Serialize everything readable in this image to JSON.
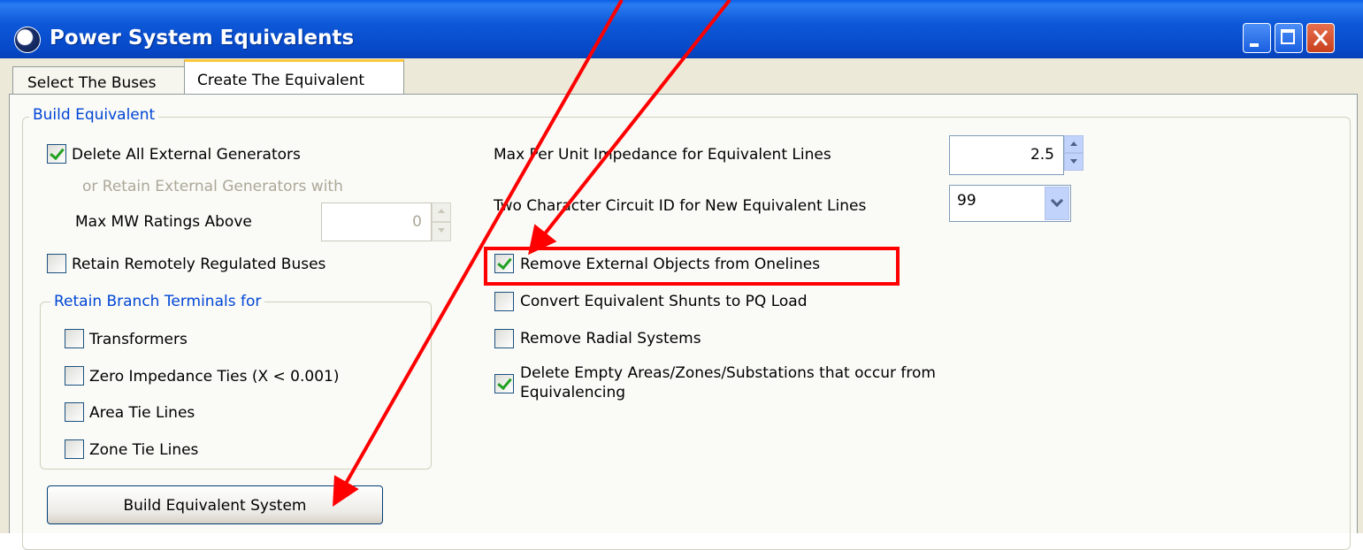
{
  "window": {
    "title": "Power System Equivalents",
    "icon": "globe-icon"
  },
  "tabs": [
    {
      "label": "Select The Buses",
      "active": false
    },
    {
      "label": "Create The Equivalent",
      "active": true
    }
  ],
  "build_group": {
    "legend": "Build Equivalent",
    "delete_external_generators": {
      "label": "Delete All External Generators",
      "checked": true
    },
    "retain_generators_text": "or Retain External Generators with",
    "max_mw": {
      "label": "Max MW Ratings Above",
      "value": "0"
    },
    "retain_remotely_regulated": {
      "label": "Retain Remotely Regulated Buses",
      "checked": false
    },
    "branch_group": {
      "legend": "Retain Branch Terminals for",
      "items": [
        {
          "label": "Transformers",
          "checked": false
        },
        {
          "label": "Zero Impedance Ties (X < 0.001)",
          "checked": false
        },
        {
          "label": "Area Tie Lines",
          "checked": false
        },
        {
          "label": "Zone Tie Lines",
          "checked": false
        }
      ]
    },
    "max_impedance": {
      "label": "Max Per Unit Impedance for Equivalent Lines",
      "value": "2.5"
    },
    "circuit_id": {
      "label": "Two Character Circuit ID for New Equivalent Lines",
      "value": "99"
    },
    "options": [
      {
        "label": "Remove External Objects from Onelines",
        "checked": true
      },
      {
        "label": "Convert Equivalent Shunts to PQ Load",
        "checked": false
      },
      {
        "label": "Remove Radial Systems",
        "checked": false
      },
      {
        "label_line1": "Delete Empty Areas/Zones/Substations that occur from",
        "label_line2": "Equivalencing",
        "checked": true
      }
    ],
    "build_button": "Build Equivalent System"
  },
  "annotation_color": "#FF0000"
}
